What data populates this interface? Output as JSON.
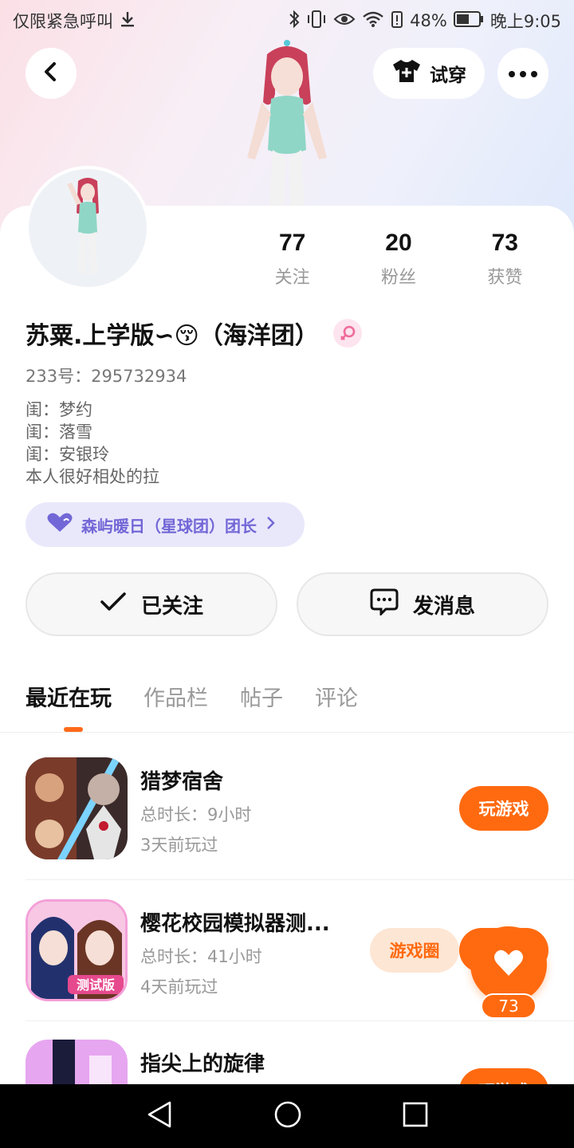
{
  "status_bar": {
    "left_text": "仅限紧急呼叫",
    "battery": "48%",
    "time": "晚上9:05"
  },
  "header": {
    "try_on_label": "试穿"
  },
  "profile": {
    "stats": [
      {
        "value": "77",
        "label": "关注"
      },
      {
        "value": "20",
        "label": "粉丝"
      },
      {
        "value": "73",
        "label": "获赞"
      }
    ],
    "username": "苏粟.上学版∽😚（海洋团）",
    "uid": "233号：295732934",
    "bio_lines": [
      "闺：梦约",
      "闺：落雪",
      "闺：安银玲",
      "本人很好相处的拉"
    ],
    "club_label": "森屿暖日（星球团）团长"
  },
  "actions": {
    "follow_label": "已关注",
    "message_label": "发消息"
  },
  "tabs": [
    "最近在玩",
    "作品栏",
    "帖子",
    "评论"
  ],
  "games": [
    {
      "title": "猎梦宿舍",
      "duration": "总时长：9小时",
      "last_played": "3天前玩过",
      "button": "玩游戏"
    },
    {
      "title": "樱花校园模拟器测...",
      "duration": "总时长：41小时",
      "last_played": "4天前玩过",
      "button": "玩游戏",
      "secondary_button": "游戏圈"
    },
    {
      "title": "指尖上的旋律",
      "button": "玩游戏"
    }
  ],
  "like_fab": {
    "count": "73"
  },
  "colors": {
    "accent_orange": "#ff6a10",
    "club_purple": "#7267d6"
  }
}
